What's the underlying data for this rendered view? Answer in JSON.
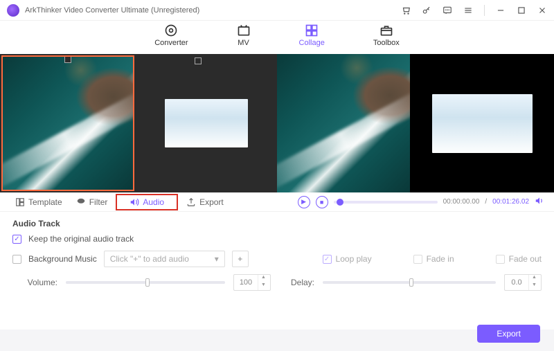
{
  "app": {
    "title": "ArkThinker Video Converter Ultimate (Unregistered)"
  },
  "nav": {
    "items": [
      {
        "label": "Converter"
      },
      {
        "label": "MV"
      },
      {
        "label": "Collage"
      },
      {
        "label": "Toolbox"
      }
    ]
  },
  "tabs": {
    "template": "Template",
    "filter": "Filter",
    "audio": "Audio",
    "export": "Export"
  },
  "playback": {
    "current": "00:00:00.00",
    "total": "00:01:26.02"
  },
  "audio_panel": {
    "title": "Audio Track",
    "keep_original": "Keep the original audio track",
    "bg_music_label": "Background Music",
    "bg_music_placeholder": "Click \"+\" to add audio",
    "loop": "Loop play",
    "fade_in": "Fade in",
    "fade_out": "Fade out",
    "volume_label": "Volume:",
    "volume_value": "100",
    "delay_label": "Delay:",
    "delay_value": "0.0"
  },
  "footer": {
    "export": "Export"
  }
}
